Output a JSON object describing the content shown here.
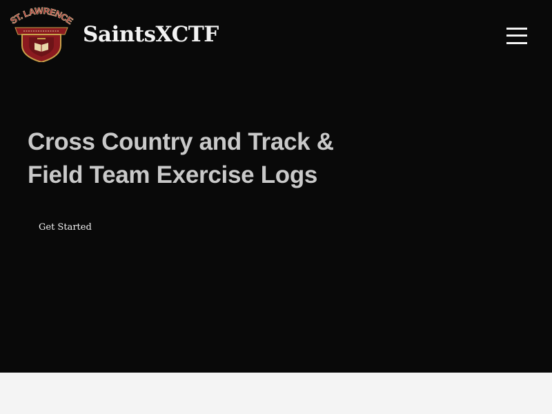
{
  "header": {
    "brand": "SaintsXCTF",
    "logo": {
      "text": "ST. LAWRENCE",
      "icon": "st-lawrence-shield-logo",
      "colors": {
        "shield": "#8b1a1f",
        "gold": "#c9a24a"
      }
    },
    "menu_icon": "hamburger-menu-icon"
  },
  "hero": {
    "headline": "Cross Country and Track & Field Team Exercise Logs",
    "cta_label": "Get Started",
    "background": "#090909"
  },
  "colors": {
    "headline": "#c9c9c9",
    "brand": "#f2f2f2",
    "page_bg": "#f4f4f4"
  }
}
